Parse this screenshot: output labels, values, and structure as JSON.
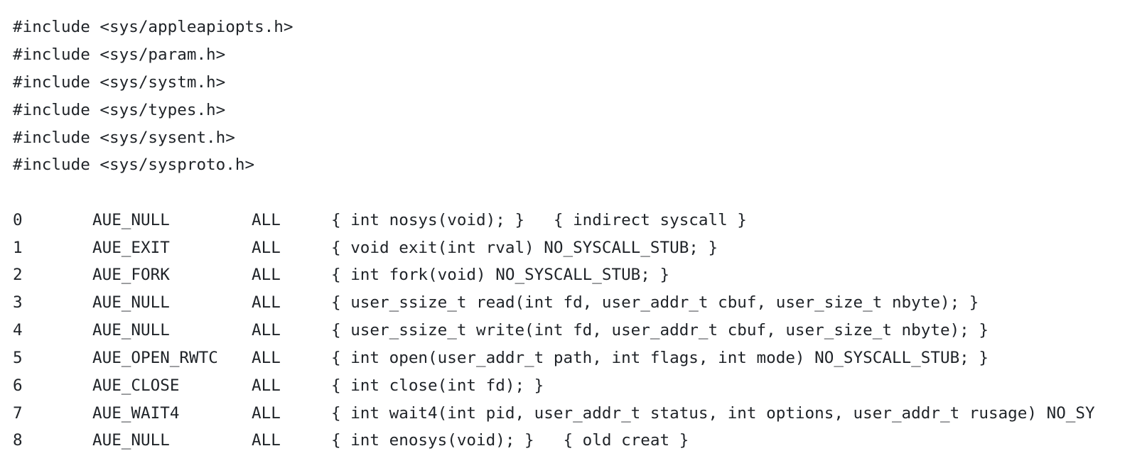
{
  "includes": [
    "#include <sys/appleapiopts.h>",
    "#include <sys/param.h>",
    "#include <sys/systm.h>",
    "#include <sys/types.h>",
    "#include <sys/sysent.h>",
    "#include <sys/sysproto.h>"
  ],
  "syscalls": [
    {
      "number": "0",
      "audit_event": "AUE_NULL",
      "files": "ALL",
      "declaration": "{ int nosys(void); }   { indirect syscall }"
    },
    {
      "number": "1",
      "audit_event": "AUE_EXIT",
      "files": "ALL",
      "declaration": "{ void exit(int rval) NO_SYSCALL_STUB; }"
    },
    {
      "number": "2",
      "audit_event": "AUE_FORK",
      "files": "ALL",
      "declaration": "{ int fork(void) NO_SYSCALL_STUB; }"
    },
    {
      "number": "3",
      "audit_event": "AUE_NULL",
      "files": "ALL",
      "declaration": "{ user_ssize_t read(int fd, user_addr_t cbuf, user_size_t nbyte); }"
    },
    {
      "number": "4",
      "audit_event": "AUE_NULL",
      "files": "ALL",
      "declaration": "{ user_ssize_t write(int fd, user_addr_t cbuf, user_size_t nbyte); }"
    },
    {
      "number": "5",
      "audit_event": "AUE_OPEN_RWTC",
      "files": "ALL",
      "declaration": "{ int open(user_addr_t path, int flags, int mode) NO_SYSCALL_STUB; }"
    },
    {
      "number": "6",
      "audit_event": "AUE_CLOSE",
      "files": "ALL",
      "declaration": "{ int close(int fd); }"
    },
    {
      "number": "7",
      "audit_event": "AUE_WAIT4",
      "files": "ALL",
      "declaration": "{ int wait4(int pid, user_addr_t status, int options, user_addr_t rusage) NO_SY"
    },
    {
      "number": "8",
      "audit_event": "AUE_NULL",
      "files": "ALL",
      "declaration": "{ int enosys(void); }   { old creat }"
    }
  ]
}
